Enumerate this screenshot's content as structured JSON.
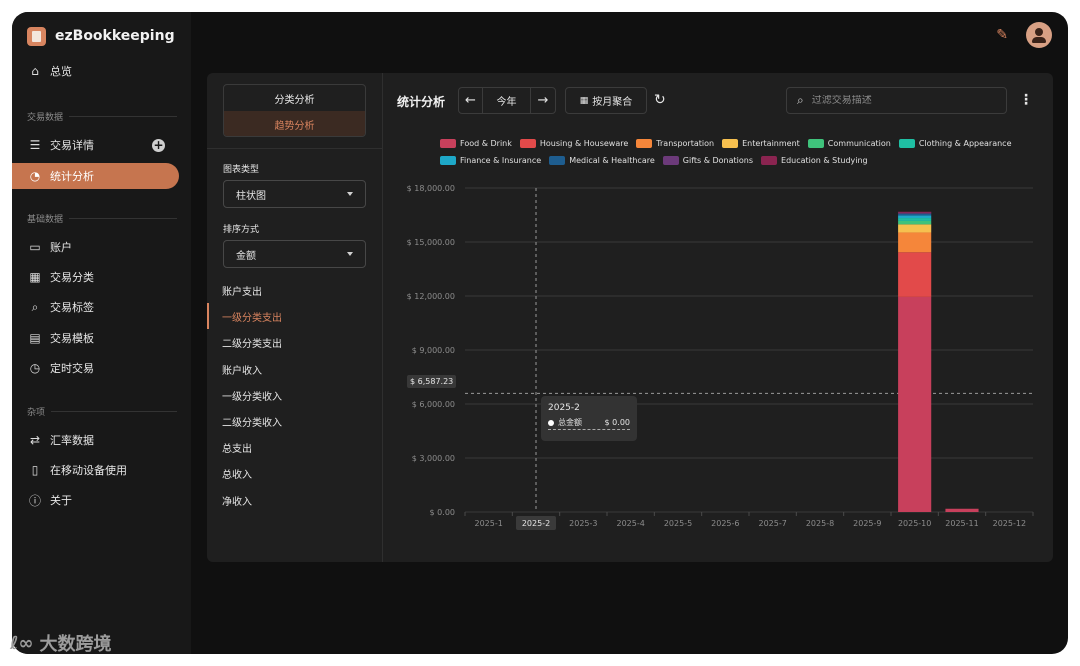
{
  "app": {
    "name": "ezBookkeeping"
  },
  "sidebar": {
    "items": [
      {
        "label": "总览",
        "icon": "home-icon",
        "glyph": "⌂",
        "top": 46
      },
      {
        "label": "交易详情",
        "icon": "list-icon",
        "glyph": "☰",
        "top": 120
      },
      {
        "label": "统计分析",
        "icon": "pie-chart-icon",
        "glyph": "◔",
        "top": 151
      },
      {
        "label": "账户",
        "icon": "card-icon",
        "glyph": "▭",
        "top": 222
      },
      {
        "label": "交易分类",
        "icon": "category-icon",
        "glyph": "▦",
        "top": 252
      },
      {
        "label": "交易标签",
        "icon": "tag-icon",
        "glyph": "⌕",
        "top": 282
      },
      {
        "label": "交易模板",
        "icon": "template-icon",
        "glyph": "▤",
        "top": 313
      },
      {
        "label": "定时交易",
        "icon": "schedule-icon",
        "glyph": "◷",
        "top": 343
      },
      {
        "label": "汇率数据",
        "icon": "exchange-icon",
        "glyph": "⇄",
        "top": 415
      },
      {
        "label": "在移动设备使用",
        "icon": "mobile-icon",
        "glyph": "▯",
        "top": 445
      },
      {
        "label": "关于",
        "icon": "info-icon",
        "glyph": "ⓘ",
        "top": 475
      }
    ],
    "sections": [
      "交易数据",
      "基础数据",
      "杂项"
    ],
    "add_symbol": "+"
  },
  "topbar": {
    "tool_glyph": "✎"
  },
  "left_panel": {
    "tabs": [
      "分类分析",
      "趋势分析"
    ],
    "chart_type_label": "图表类型",
    "chart_type_value": "柱状图",
    "sort_label": "排序方式",
    "sort_value": "金额",
    "analysis_items": [
      "账户支出",
      "一级分类支出",
      "二级分类支出",
      "账户收入",
      "一级分类收入",
      "二级分类收入",
      "总支出",
      "总收入",
      "净收入"
    ]
  },
  "toolbar": {
    "title": "统计分析",
    "prev": "←",
    "period": "今年",
    "next": "→",
    "aggregate": "按月聚合",
    "calendar_glyph": "▦",
    "refresh_glyph": "↻",
    "search_glyph": "⌕",
    "search_placeholder": "过滤交易描述",
    "more_glyph": "⋮"
  },
  "tooltip": {
    "title": "2025-2",
    "label": "总金额",
    "value": "$ 0.00"
  },
  "crosshair": {
    "value": "$ 6,587.23",
    "y": 6587.23,
    "category": "2025-2"
  },
  "chart_data": {
    "type": "bar",
    "stacked": true,
    "categories": [
      "2025-1",
      "2025-2",
      "2025-3",
      "2025-4",
      "2025-5",
      "2025-6",
      "2025-7",
      "2025-8",
      "2025-9",
      "2025-10",
      "2025-11",
      "2025-12"
    ],
    "ylim": [
      0,
      18000
    ],
    "yticks": [
      0,
      3000,
      6000,
      9000,
      12000,
      15000,
      18000
    ],
    "ytick_labels": [
      "$ 0.00",
      "$ 3,000.00",
      "$ 6,000.00",
      "$ 9,000.00",
      "$ 12,000.00",
      "$ 15,000.00",
      "$ 18,000.00"
    ],
    "grid": true,
    "legend_position": "top",
    "series": [
      {
        "name": "Food & Drink",
        "color": "#c8405c",
        "values": [
          0,
          0,
          0,
          0,
          0,
          0,
          0,
          0,
          0,
          11950,
          180,
          0
        ]
      },
      {
        "name": "Housing & Houseware",
        "color": "#e24a4a",
        "values": [
          0,
          0,
          0,
          0,
          0,
          0,
          0,
          0,
          0,
          2480,
          0,
          0
        ]
      },
      {
        "name": "Transportation",
        "color": "#f5863a",
        "values": [
          0,
          0,
          0,
          0,
          0,
          0,
          0,
          0,
          0,
          1100,
          0,
          0
        ]
      },
      {
        "name": "Entertainment",
        "color": "#f6c04f",
        "values": [
          0,
          0,
          0,
          0,
          0,
          0,
          0,
          0,
          0,
          450,
          0,
          0
        ]
      },
      {
        "name": "Communication",
        "color": "#3fc27b",
        "values": [
          0,
          0,
          0,
          0,
          0,
          0,
          0,
          0,
          0,
          190,
          0,
          0
        ]
      },
      {
        "name": "Clothing & Appearance",
        "color": "#1fbfa3",
        "values": [
          0,
          0,
          0,
          0,
          0,
          0,
          0,
          0,
          0,
          160,
          0,
          0
        ]
      },
      {
        "name": "Finance & Insurance",
        "color": "#1ea8c8",
        "values": [
          0,
          0,
          0,
          0,
          0,
          0,
          0,
          0,
          0,
          140,
          0,
          0
        ]
      },
      {
        "name": "Medical & Healthcare",
        "color": "#1e5d8f",
        "values": [
          0,
          0,
          0,
          0,
          0,
          0,
          0,
          0,
          0,
          100,
          0,
          0
        ]
      },
      {
        "name": "Gifts & Donations",
        "color": "#6c3a7a",
        "values": [
          0,
          0,
          0,
          0,
          0,
          0,
          0,
          0,
          0,
          70,
          0,
          0
        ]
      },
      {
        "name": "Education & Studying",
        "color": "#8a2450",
        "values": [
          0,
          0,
          0,
          0,
          0,
          0,
          0,
          0,
          0,
          40,
          0,
          0
        ]
      }
    ]
  },
  "watermark": {
    "text": "大数跨境",
    "glyph": "ℓ∞"
  }
}
